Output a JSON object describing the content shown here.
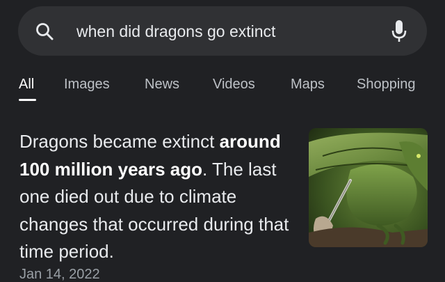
{
  "search": {
    "query": "when did dragons go extinct"
  },
  "tabs": [
    {
      "label": "All",
      "active": true
    },
    {
      "label": "Images",
      "active": false
    },
    {
      "label": "News",
      "active": false
    },
    {
      "label": "Videos",
      "active": false
    },
    {
      "label": "Maps",
      "active": false
    },
    {
      "label": "Shopping",
      "active": false
    }
  ],
  "result": {
    "text_before": "Dragons became extinct ",
    "text_bold": "around 100 million years ago",
    "text_after": ". The last one died out due to climate changes that occurred during that time period.",
    "date": "Jan 14, 2022",
    "thumbnail": "green-dragon-image"
  },
  "icons": {
    "search": "search-icon",
    "mic": "mic-icon"
  },
  "colors": {
    "background": "#202124",
    "search_bar": "#303134",
    "text_primary": "#e8eaed",
    "text_secondary": "#bdc1c6",
    "text_muted": "#9aa0a6"
  }
}
